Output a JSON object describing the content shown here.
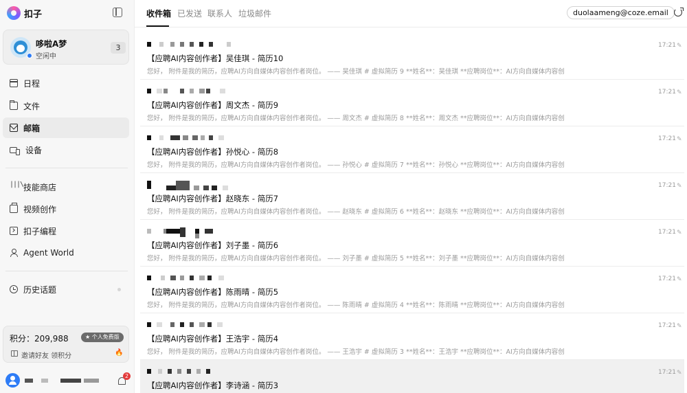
{
  "app": {
    "brand_name": "扣子"
  },
  "profile": {
    "name": "哆啦A梦",
    "status": "空闲中",
    "count": "3"
  },
  "nav": {
    "main": [
      {
        "label": "日程",
        "icon": "calendar-icon"
      },
      {
        "label": "文件",
        "icon": "folder-icon"
      },
      {
        "label": "邮箱",
        "icon": "mail-icon",
        "active": true
      },
      {
        "label": "设备",
        "icon": "device-icon"
      }
    ],
    "tools": [
      {
        "label": "技能商店",
        "icon": "skill-store-icon"
      },
      {
        "label": "视频创作",
        "icon": "video-icon"
      },
      {
        "label": "扣子编程",
        "icon": "code-icon"
      },
      {
        "label": "Agent World",
        "icon": "agent-icon"
      }
    ],
    "history": {
      "label": "历史话题",
      "icon": "history-icon"
    }
  },
  "points": {
    "label": "积分：209,988",
    "plan_badge": "★ 个人免费版",
    "invite_text": "邀请好友 领积分"
  },
  "notifications": {
    "badge": "2"
  },
  "tabs": [
    "收件箱",
    "已发送",
    "联系人",
    "垃圾邮件"
  ],
  "account": {
    "email": "duolaameng@coze.email"
  },
  "mails": [
    {
      "time": "17:21",
      "subject": "【应聘AI内容创作者】吴佳琪 - 简历10",
      "preview": "您好， 附件是我的简历，应聘AI方向自媒体内容创作者岗位。 —— 吴佳琪 # 虚拟简历 9 **姓名**：吴佳琪 **应聘岗位**：AI方向自媒体内容创"
    },
    {
      "time": "17:21",
      "subject": "【应聘AI内容创作者】周文杰 - 简历9",
      "preview": "您好， 附件是我的简历，应聘AI方向自媒体内容创作者岗位。 —— 周文杰 # 虚拟简历 8 **姓名**：周文杰 **应聘岗位**：AI方向自媒体内容创"
    },
    {
      "time": "17:21",
      "subject": "【应聘AI内容创作者】孙悦心 - 简历8",
      "preview": "您好， 附件是我的简历，应聘AI方向自媒体内容创作者岗位。 —— 孙悦心 # 虚拟简历 7 **姓名**：孙悦心 **应聘岗位**：AI方向自媒体内容创"
    },
    {
      "time": "17:21",
      "subject": "【应聘AI内容创作者】赵晓东 - 简历7",
      "preview": "您好， 附件是我的简历，应聘AI方向自媒体内容创作者岗位。 —— 赵晓东 # 虚拟简历 6 **姓名**：赵晓东 **应聘岗位**：AI方向自媒体内容创"
    },
    {
      "time": "17:21",
      "subject": "【应聘AI内容创作者】刘子墨 - 简历6",
      "preview": "您好， 附件是我的简历，应聘AI方向自媒体内容创作者岗位。 —— 刘子墨 # 虚拟简历 5 **姓名**：刘子墨 **应聘岗位**：AI方向自媒体内容创"
    },
    {
      "time": "17:21",
      "subject": "【应聘AI内容创作者】陈雨晴 - 简历5",
      "preview": "您好， 附件是我的简历，应聘AI方向自媒体内容创作者岗位。 —— 陈雨晴 # 虚拟简历 4 **姓名**：陈雨晴 **应聘岗位**：AI方向自媒体内容创"
    },
    {
      "time": "17:21",
      "subject": "【应聘AI内容创作者】王浩宇 - 简历4",
      "preview": "您好， 附件是我的简历，应聘AI方向自媒体内容创作者岗位。 —— 王浩宇 # 虚拟简历 3 **姓名**：王浩宇 **应聘岗位**：AI方向自媒体内容创"
    },
    {
      "time": "17:21",
      "subject": "【应聘AI内容创作者】李诗涵 - 简历3",
      "preview": ""
    }
  ]
}
